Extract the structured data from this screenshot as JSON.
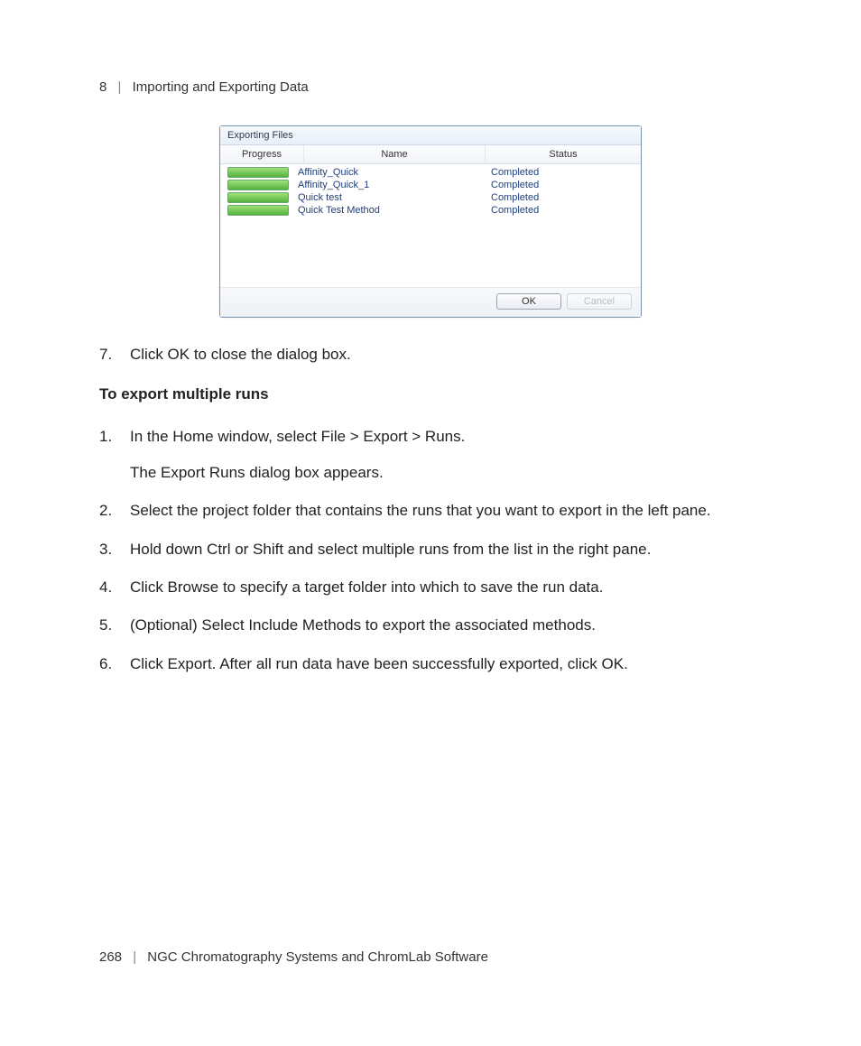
{
  "header": {
    "chapter_num": "8",
    "separator": "|",
    "chapter_title": "Importing and Exporting Data"
  },
  "dialog": {
    "title": "Exporting Files",
    "columns": {
      "progress": "Progress",
      "name": "Name",
      "status": "Status"
    },
    "rows": [
      {
        "name": "Affinity_Quick",
        "status": "Completed"
      },
      {
        "name": "Affinity_Quick_1",
        "status": "Completed"
      },
      {
        "name": "Quick test",
        "status": "Completed"
      },
      {
        "name": "Quick Test Method",
        "status": "Completed"
      }
    ],
    "buttons": {
      "ok": "OK",
      "cancel": "Cancel"
    }
  },
  "step7": {
    "num": "7.",
    "text": "Click OK to close the dialog box."
  },
  "subheading": "To export multiple runs",
  "steps": [
    {
      "num": "1.",
      "text": "In the Home window, select File > Export > Runs.",
      "after": "The Export Runs dialog box appears."
    },
    {
      "num": "2.",
      "text": "Select the project folder that contains the runs that you want to export in the left pane."
    },
    {
      "num": "3.",
      "text": "Hold down Ctrl or Shift and select multiple runs from the list in the right pane."
    },
    {
      "num": "4.",
      "text": "Click Browse to specify a target folder into which to save the run data."
    },
    {
      "num": "5.",
      "text": "(Optional) Select Include Methods to export the associated methods."
    },
    {
      "num": "6.",
      "text": "Click Export. After all run data have been successfully exported, click OK."
    }
  ],
  "footer": {
    "page_num": "268",
    "separator": "|",
    "doc_title": "NGC Chromatography Systems and ChromLab Software"
  }
}
